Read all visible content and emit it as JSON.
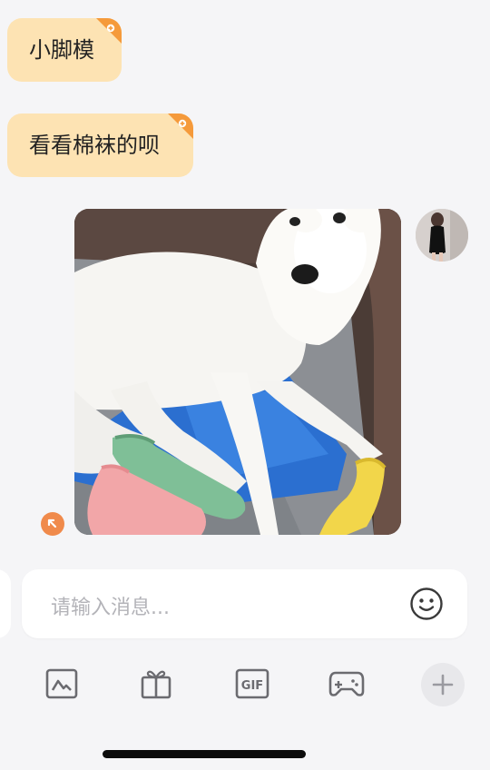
{
  "messages": [
    {
      "text": "小脚模",
      "side": "left",
      "badge": "plus-badge"
    },
    {
      "text": "看看棉袜的呗",
      "side": "left",
      "badge": "plus-badge"
    }
  ],
  "image_message": {
    "side": "right",
    "content": "photo of white dog lying on a cushion wearing colorful socks"
  },
  "composer": {
    "placeholder": "请输入消息..."
  },
  "toolbar": {
    "items": [
      "album-icon",
      "gift-icon",
      "gif-icon",
      "game-controller-icon",
      "plus-icon"
    ],
    "gif_label": "GIF"
  },
  "colors": {
    "bubble_bg": "#fde3b3",
    "badge": "#f59a3b",
    "accent": "#f08a4b",
    "background": "#f5f5f7"
  }
}
